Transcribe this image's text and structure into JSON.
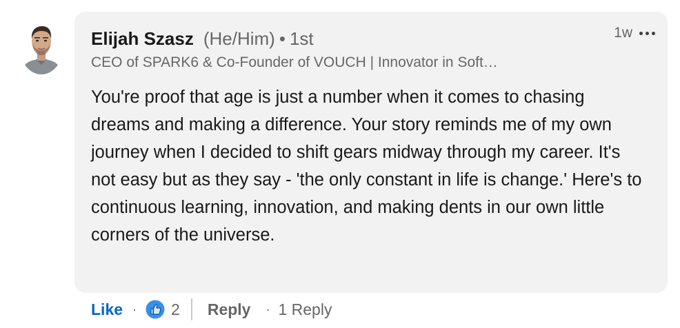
{
  "author": {
    "name": "Elijah Szasz",
    "pronouns": "(He/Him)",
    "separator": "•",
    "degree": "1st",
    "headline": "CEO of SPARK6 & Co-Founder of VOUCH | Innovator in Soft…",
    "avatar_icon": "profile-photo"
  },
  "meta": {
    "time_ago": "1w",
    "more_icon": "ellipsis-icon"
  },
  "comment": {
    "text": "You're proof that age is just a number when it comes to chasing dreams and making a difference. Your story reminds me of my own journey when I decided to shift gears midway through my career. It's not easy but as they say - 'the only constant in life is change.' Here's to continuous learning, innovation, and making dents in our own little corners of the universe."
  },
  "actions": {
    "like_label": "Like",
    "dot": "·",
    "reaction_icon": "thumbs-up-icon",
    "reaction_count": "2",
    "reply_label": "Reply",
    "replies_label": "1 Reply"
  },
  "colors": {
    "bubble_bg": "#f2f2f2",
    "like_blue": "#0a66c2",
    "text_primary": "#191919",
    "text_secondary": "#666666"
  }
}
